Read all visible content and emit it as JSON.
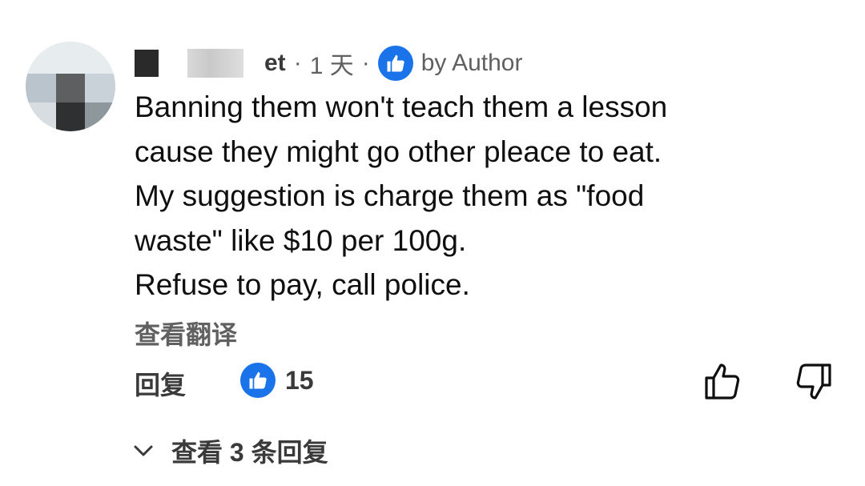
{
  "comment": {
    "author_visible": "et",
    "time": "1 天",
    "separator": "·",
    "author_badge": "by Author",
    "lines": [
      "Banning them won't teach them a lesson",
      "cause they might go other pleace to eat.",
      "My suggestion is charge them as \"food",
      "waste\" like $10 per 100g.",
      "Refuse to pay, call police."
    ],
    "translate_label": "查看翻译",
    "reply_label": "回复",
    "like_count": "15",
    "view_replies_label": "查看 3 条回复"
  },
  "colors": {
    "accent_blue": "#1a73e8",
    "text_primary": "#0f0f0f",
    "text_secondary": "#606060"
  },
  "icons": {
    "author_like_badge": "thumbs-up-filled-icon",
    "like_button": "thumbs-up-outline-icon",
    "dislike_button": "thumbs-down-outline-icon",
    "expand": "chevron-down-icon"
  }
}
